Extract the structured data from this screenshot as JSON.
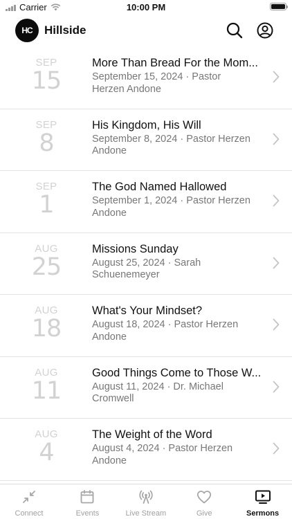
{
  "status_bar": {
    "carrier": "Carrier",
    "time": "10:00 PM",
    "battery_level": 1.0
  },
  "header": {
    "logo_text": "HC",
    "title": "Hillside"
  },
  "sermons": [
    {
      "month": "SEP",
      "day": "15",
      "title": "More Than Bread For the Mom...",
      "subtitle": "September 15, 2024 · Pastor Herzen Andone"
    },
    {
      "month": "SEP",
      "day": "8",
      "title": "His Kingdom, His Will",
      "subtitle": "September 8, 2024 · Pastor Herzen Andone"
    },
    {
      "month": "SEP",
      "day": "1",
      "title": "The God Named Hallowed",
      "subtitle": "September 1, 2024 · Pastor Herzen Andone"
    },
    {
      "month": "AUG",
      "day": "25",
      "title": "Missions Sunday",
      "subtitle": "August 25, 2024 · Sarah Schuenemeyer"
    },
    {
      "month": "AUG",
      "day": "18",
      "title": "What's Your Mindset?",
      "subtitle": "August 18, 2024 · Pastor Herzen Andone"
    },
    {
      "month": "AUG",
      "day": "11",
      "title": "Good Things Come to Those W...",
      "subtitle": "August 11, 2024 · Dr. Michael Cromwell"
    },
    {
      "month": "AUG",
      "day": "4",
      "title": "The Weight of the Word",
      "subtitle": "August 4, 2024 · Pastor Herzen Andone"
    }
  ],
  "tabs": [
    {
      "label": "Connect",
      "icon": "connect-icon"
    },
    {
      "label": "Events",
      "icon": "calendar-icon"
    },
    {
      "label": "Live Stream",
      "icon": "broadcast-icon"
    },
    {
      "label": "Give",
      "icon": "heart-icon"
    },
    {
      "label": "Sermons",
      "icon": "play-screen-icon",
      "active": true
    }
  ],
  "colors": {
    "accent": "#111111",
    "muted": "#a0a0a0",
    "date": "#d2d2d2",
    "divider": "#e3e3e3"
  }
}
